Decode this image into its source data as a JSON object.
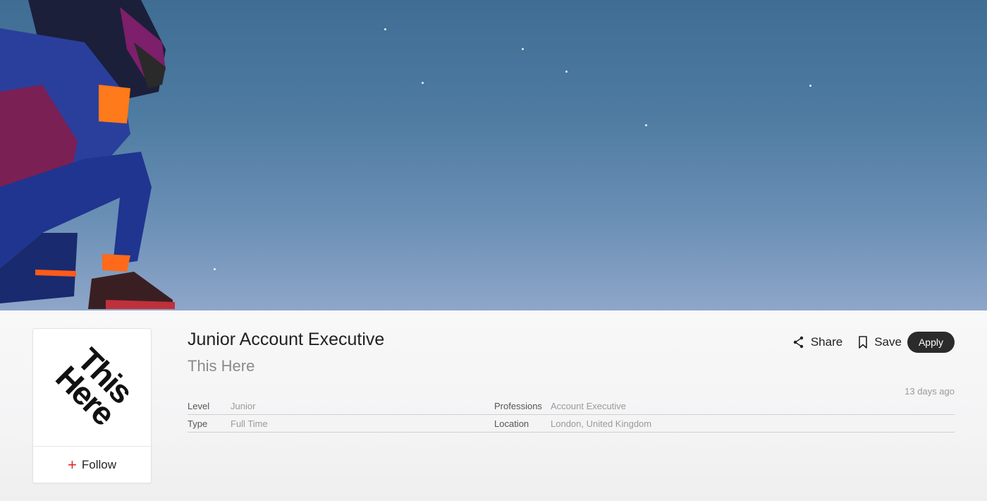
{
  "job": {
    "title": "Junior Account Executive",
    "company": "This Here",
    "posted": "13 days ago"
  },
  "company_card": {
    "logo_text_line1": "This",
    "logo_text_line2": "Here",
    "follow_label": "Follow"
  },
  "actions": {
    "share_label": "Share",
    "save_label": "Save",
    "apply_label": "Apply"
  },
  "meta": {
    "rows": [
      {
        "label": "Level",
        "value": "Junior",
        "label2": "Professions",
        "value2": "Account Executive"
      },
      {
        "label": "Type",
        "value": "Full Time",
        "label2": "Location",
        "value2": "London, United Kingdom"
      }
    ]
  },
  "colors": {
    "accent": "#e0262b",
    "apply_bg": "#2b2b2b",
    "sky": "#4d7aa0"
  },
  "icons": [
    "share-icon",
    "bookmark-icon",
    "plus-icon"
  ]
}
